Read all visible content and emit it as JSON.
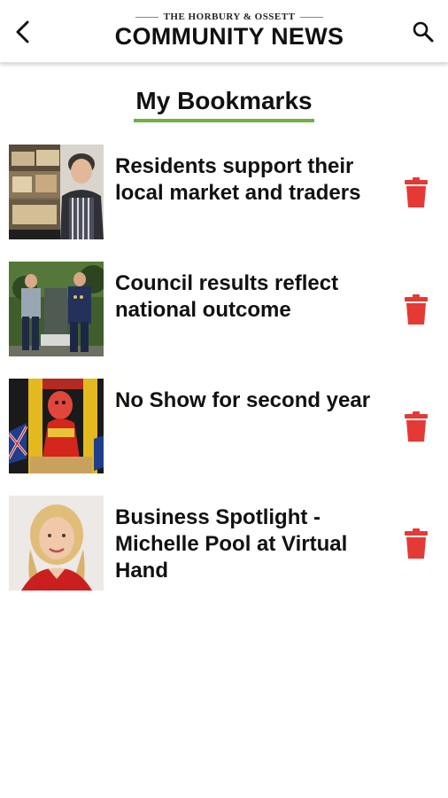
{
  "header": {
    "masthead_top": "THE HORBURY & OSSETT",
    "masthead_main": "COMMUNITY NEWS"
  },
  "page": {
    "title": "My Bookmarks"
  },
  "bookmarks": [
    {
      "headline": "Residents support their local market and traders",
      "thumb": "market-trader-photo"
    },
    {
      "headline": "Council results reflect national outcome",
      "thumb": "council-memorial-photo"
    },
    {
      "headline": "No Show for second year",
      "thumb": "punch-puppet-photo"
    },
    {
      "headline": "Business Spotlight - Michelle Pool at Virtual Hand",
      "thumb": "michelle-portrait-photo"
    }
  ],
  "colors": {
    "accent_green": "#6db33f",
    "delete_red": "#e53935"
  },
  "icons": {
    "back": "chevron-left-icon",
    "search": "search-icon",
    "delete": "trash-icon"
  }
}
